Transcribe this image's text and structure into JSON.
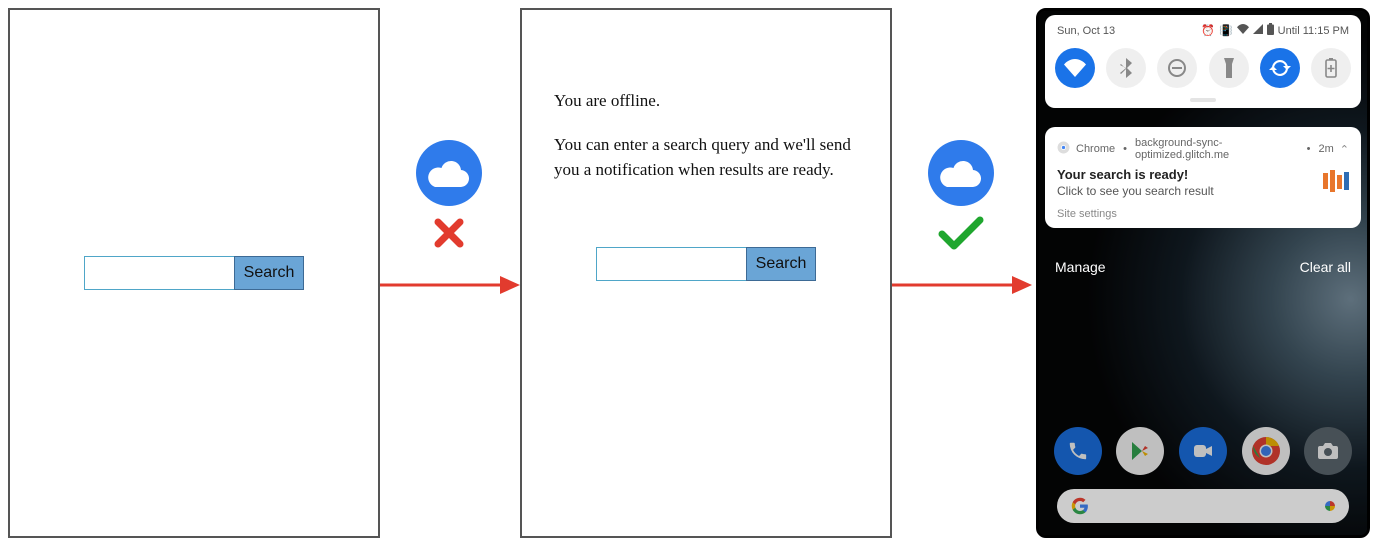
{
  "frame1": {
    "search_button": "Search"
  },
  "frame2": {
    "offline_heading": "You are offline.",
    "offline_body": "You can enter a search query and we'll send you a notification when results are ready.",
    "search_button": "Search"
  },
  "connector1": {
    "status": "fail"
  },
  "connector2": {
    "status": "ok"
  },
  "phone": {
    "status_bar": {
      "date": "Sun, Oct 13",
      "until": "Until 11:15 PM"
    },
    "toggles": [
      {
        "name": "wifi",
        "on": true
      },
      {
        "name": "bluetooth",
        "on": false
      },
      {
        "name": "dnd",
        "on": false
      },
      {
        "name": "flashlight",
        "on": false
      },
      {
        "name": "autorotate",
        "on": true
      },
      {
        "name": "battery",
        "on": false
      }
    ],
    "notification": {
      "app": "Chrome",
      "origin": "background-sync-optimized.glitch.me",
      "age": "2m",
      "title": "Your search is ready!",
      "subtitle": "Click to see you search result",
      "settings": "Site settings"
    },
    "shade": {
      "manage": "Manage",
      "clear": "Clear all"
    },
    "dock": [
      "phone",
      "play",
      "duo",
      "chrome",
      "camera"
    ]
  }
}
